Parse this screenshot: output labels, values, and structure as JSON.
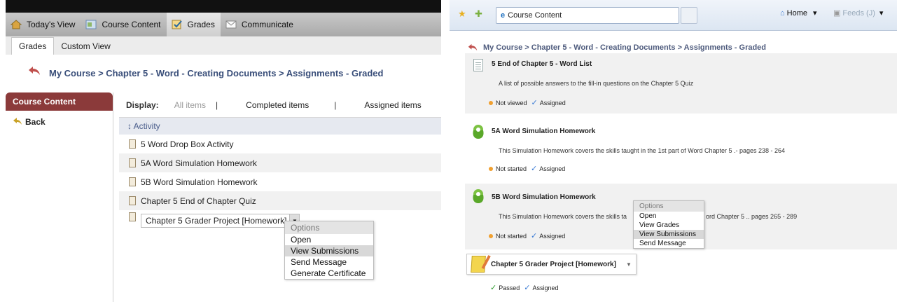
{
  "left": {
    "nav": [
      {
        "label": "Today's View",
        "icon": "home-icon"
      },
      {
        "label": "Course Content",
        "icon": "course-content-icon"
      },
      {
        "label": "Grades",
        "icon": "grades-icon",
        "active": true
      },
      {
        "label": "Communicate",
        "icon": "envelope-icon"
      }
    ],
    "subtabs": [
      "Grades",
      "Custom View"
    ],
    "breadcrumb": "My Course > Chapter 5 - Word - Creating Documents > Assignments - Graded",
    "sidebar": {
      "header": "Course Content",
      "back": "Back"
    },
    "display": {
      "label": "Display:",
      "all": "All items",
      "sep": "|",
      "completed": "Completed items",
      "sep2": "|",
      "assigned": "Assigned items"
    },
    "activity_header": "↕ Activity",
    "items": [
      "5 Word Drop Box Activity",
      "5A Word Simulation Homework",
      "5B Word Simulation Homework",
      "Chapter 5 End of Chapter Quiz"
    ],
    "grader_item": "Chapter 5 Grader Project [Homework]",
    "menu": {
      "header": "Options",
      "items": [
        "Open",
        "View Submissions",
        "Send Message",
        "Generate Certificate"
      ],
      "highlighted": "View Submissions"
    }
  },
  "right": {
    "tab_title": "Course Content",
    "home_label": "Home",
    "home_arrow": "▾",
    "feeds_label": "Feeds (J)",
    "feeds_arrow": "▾",
    "breadcrumb": "My Course > Chapter 5 - Word - Creating Documents > Assignments - Graded",
    "blocks": [
      {
        "title": "5 End of Chapter 5 - Word List",
        "desc": "A list of possible answers to the fill-in questions on the Chapter 5 Quiz",
        "status": "Not viewed",
        "assigned": "Assigned"
      },
      {
        "title": "5A Word Simulation Homework",
        "desc": "This Simulation Homework covers the skills taught in the 1st part of Word Chapter 5 .- pages 238 - 264",
        "status": "Not started",
        "assigned": "Assigned"
      },
      {
        "title": "5B Word Simulation Homework",
        "desc_a": "This Simulation Homework covers the skills ta",
        "desc_b": "ord Chapter 5 .. pages 265 - 289",
        "status": "Not started",
        "assigned": "Assigned"
      }
    ],
    "grader": {
      "title": "Chapter 5 Grader Project [Homework]",
      "passed": "Passed",
      "assigned": "Assigned"
    },
    "menu": {
      "header": "Options",
      "items": [
        "Open",
        "View Grades",
        "View Submissions",
        "Send Message"
      ],
      "highlighted": "View Submissions"
    }
  },
  "colors": {
    "sidebar_header": "#8b3a3a",
    "breadcrumb": "#3a4f7a",
    "back_arrow": "#c0504d",
    "assigned_check": "#3a7bd5",
    "not_started_dot": "#f0a030"
  }
}
